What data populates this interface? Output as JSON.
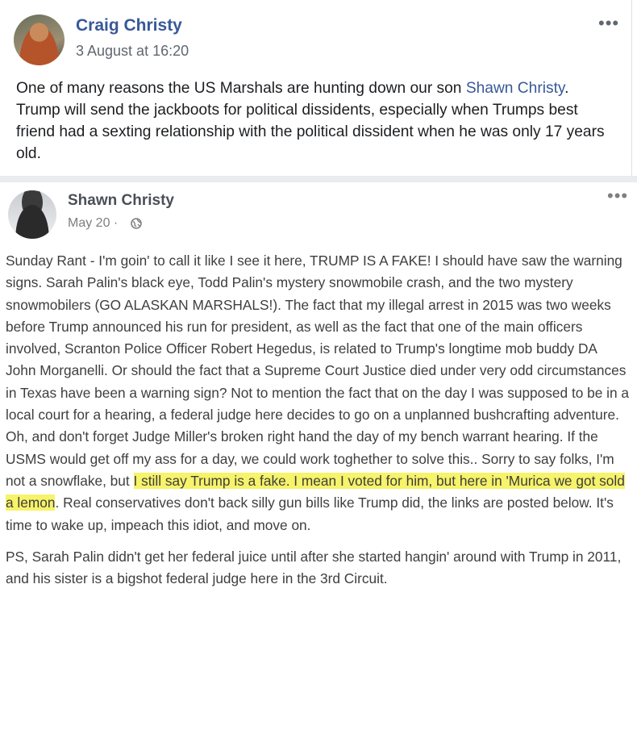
{
  "shared_post": {
    "author": "Craig Christy",
    "date": "3 August at 16:20",
    "options": "•••",
    "text_before": "One of many reasons the US Marshals are hunting down our son ",
    "mention": "Shawn Christy",
    "text_after": ". Trump will send the jackboots for political dissidents, especially when Trumps best friend had a sexting relationship with the political dissident when he was only 17 years old."
  },
  "original_post": {
    "author": "Shawn Christy",
    "date": "May 20 ·",
    "options": "•••",
    "paragraph1_before": "Sunday Rant - I'm goin' to call it like I see it here, TRUMP IS A FAKE! I should have saw the warning signs. Sarah Palin's black eye, Todd Palin's mystery snowmobile crash, and the two mystery snowmobilers (GO ALASKAN MARSHALS!). The fact that my illegal arrest in 2015 was two weeks before Trump announced his run for president, as well as the fact that one of the main officers involved, Scranton Police Officer Robert Hegedus, is related to Trump's longtime mob buddy DA John Morganelli. Or should the fact that a Supreme Court Justice died under very odd circumstances in Texas have been a warning sign? Not to mention the fact that on the day I was supposed to be in a local court for a hearing, a federal judge here decides to go on a unplanned bushcrafting adventure. Oh, and don't forget Judge Miller's broken right hand the day of my bench warrant hearing. If the USMS would get off my ass for a day, we could work toghether to solve this.. Sorry to say folks, I'm not a snowflake, but ",
    "paragraph1_highlight": "I still say Trump is a fake. I mean I voted for him, but here in 'Murica we got sold a lemon",
    "paragraph1_after": ". Real conservatives don't back silly gun bills like Trump did, the links are posted below. It's time to wake up, impeach this idiot, and move on.",
    "paragraph2": "PS, Sarah Palin didn't get her federal juice until after she started hangin' around with Trump in 2011, and his sister is a bigshot federal judge here in the 3rd Circuit."
  },
  "icons": {
    "privacy": "globe-icon",
    "menu": "more-options-icon"
  },
  "colors": {
    "link": "#385898",
    "highlight": "#f7f36a",
    "divider": "#e9ebee"
  }
}
